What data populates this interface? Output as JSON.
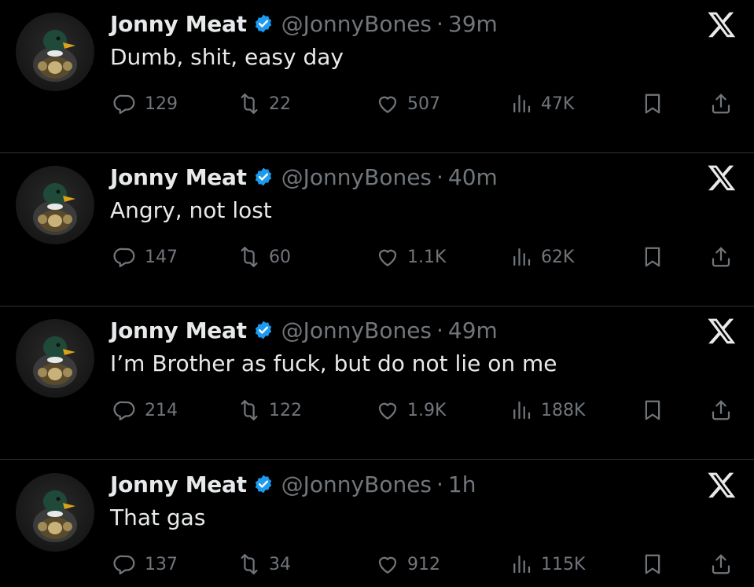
{
  "feed": {
    "tweets": [
      {
        "author": "Jonny Meat",
        "handle": "@JonnyBones",
        "separator": "·",
        "time": "39m",
        "text": "Dumb, shit, easy day",
        "replies": "129",
        "retweets": "22",
        "likes": "507",
        "views": "47K"
      },
      {
        "author": "Jonny Meat",
        "handle": "@JonnyBones",
        "separator": "·",
        "time": "40m",
        "text": "Angry, not lost",
        "replies": "147",
        "retweets": "60",
        "likes": "1.1K",
        "views": "62K"
      },
      {
        "author": "Jonny Meat",
        "handle": "@JonnyBones",
        "separator": "·",
        "time": "49m",
        "text": "I’m Brother as fuck, but do not lie on me",
        "replies": "214",
        "retweets": "122",
        "likes": "1.9K",
        "views": "188K"
      },
      {
        "author": "Jonny Meat",
        "handle": "@JonnyBones",
        "separator": "·",
        "time": "1h",
        "text": "That gas",
        "replies": "137",
        "retweets": "34",
        "likes": "912",
        "views": "115K"
      }
    ]
  },
  "icons": {
    "avatar": "duck-champion-belt-avatar",
    "verified": "verified-badge-icon",
    "brand": "x-logo-icon",
    "reply": "reply-icon",
    "retweet": "retweet-icon",
    "like": "heart-icon",
    "views": "views-icon",
    "bookmark": "bookmark-icon",
    "share": "share-icon"
  },
  "colors": {
    "background": "#000000",
    "primary_text": "#e7e9ea",
    "secondary_text": "#71767b",
    "verified_blue": "#1d9bf0",
    "divider": "#2f3336"
  }
}
